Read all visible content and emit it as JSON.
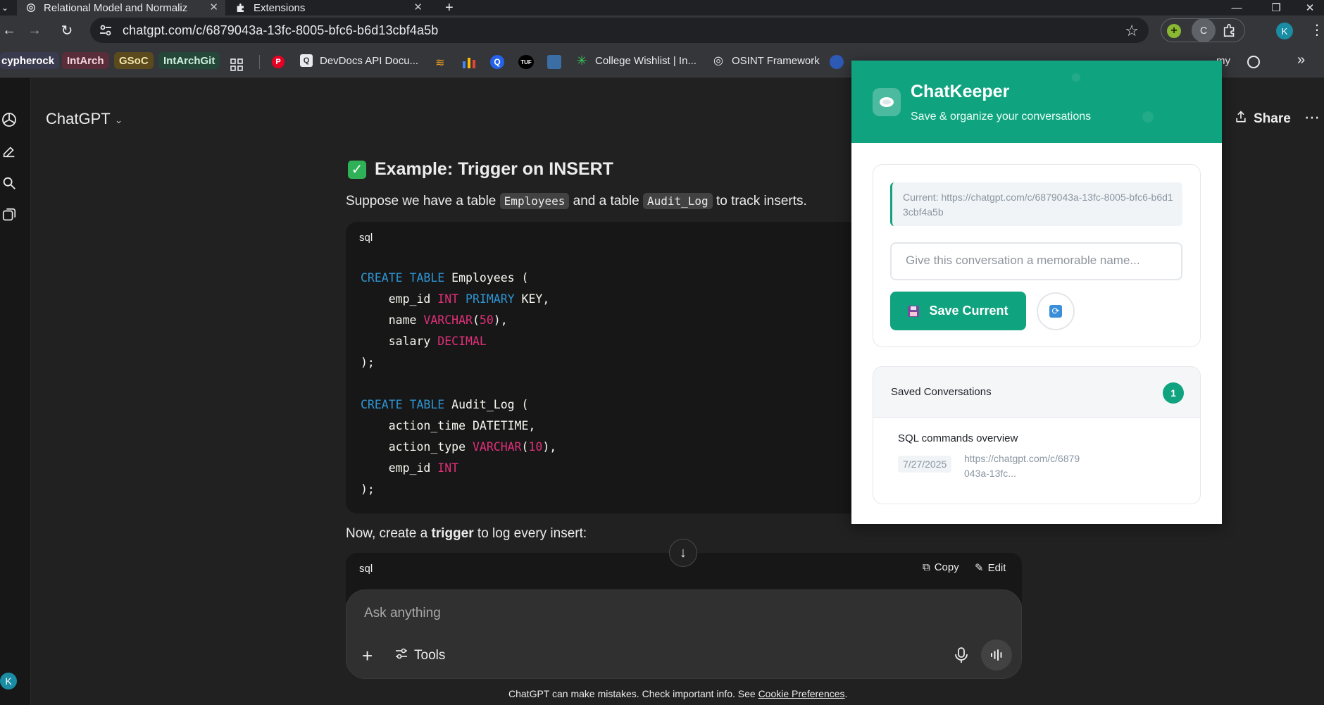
{
  "browser": {
    "tabs": [
      {
        "title": "Relational Model and Normaliz",
        "icon": "openai-icon",
        "close": "✕"
      },
      {
        "title": "Extensions",
        "icon": "puzzle-icon",
        "close": "✕"
      }
    ],
    "new_tab": "+",
    "url": "chatgpt.com/c/6879043a-13fc-8005-bfc6-b6d13cbf4a5b",
    "profile_initial": "K",
    "extension_initial": "C"
  },
  "bookmarks": [
    {
      "label": "cypherock",
      "type": "chip",
      "bg": "#3b3b4f",
      "fg": "#ffffff"
    },
    {
      "label": "IntArch",
      "type": "chip",
      "bg": "#5a2d3a",
      "fg": "#f5d6dc"
    },
    {
      "label": "GSoC",
      "type": "chip",
      "bg": "#5a4a1e",
      "fg": "#f2e3a6"
    },
    {
      "label": "IntArchGit",
      "type": "chip",
      "bg": "#24473a",
      "fg": "#cdeedd"
    },
    {
      "label": "DevDocs API Docu...",
      "type": "link"
    },
    {
      "label": "College Wishlist | In...",
      "type": "link"
    },
    {
      "label": "OSINT Framework",
      "type": "link"
    },
    {
      "label": "my",
      "type": "link"
    }
  ],
  "chatgpt": {
    "model_name": "ChatGPT",
    "share_label": "Share",
    "heading": "Example: Trigger on INSERT",
    "intro": {
      "p1": "Suppose we have a table",
      "code1": "Employees",
      "p2": "and a table",
      "code2": "Audit_Log",
      "p3": "to track inserts."
    },
    "code1_lang": "sql",
    "code2_lang": "sql",
    "trigger_text": {
      "before": "Now, create a",
      "bold": "trigger",
      "after": "to log every insert:"
    },
    "copy_label": "Copy",
    "edit_label": "Edit",
    "composer_placeholder": "Ask anything",
    "tools_label": "Tools",
    "disclaimer": "ChatGPT can make mistakes. Check important info. See",
    "disclaimer_link": "Cookie Preferences",
    "disclaimer_end": ".",
    "user_initial": "K"
  },
  "popup": {
    "title": "ChatKeeper",
    "subtitle": "Save & organize your conversations",
    "current_url": "Current: https://chatgpt.com/c/6879043a-13fc-8005-bfc6-b6d13cbf4a5b",
    "name_placeholder": "Give this conversation a memorable name...",
    "save_button": "Save Current",
    "saved_heading": "Saved Conversations",
    "saved_count": "1",
    "saved_items": [
      {
        "title": "SQL commands overview",
        "date": "7/27/2025",
        "url": "https://chatgpt.com/c/6879043a-13fc..."
      }
    ],
    "colors": {
      "brand": "#10a37f",
      "badge": "#10a37f"
    }
  }
}
